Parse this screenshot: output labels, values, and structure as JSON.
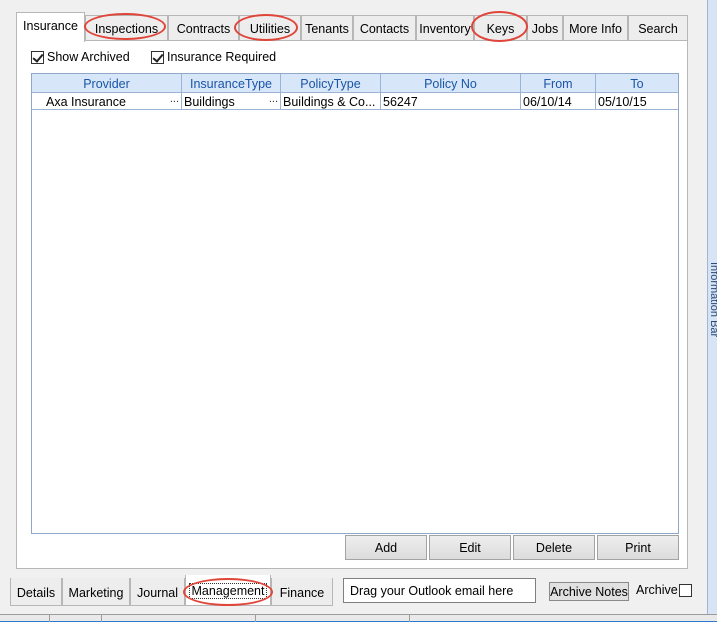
{
  "top_tabs": [
    "Insurance",
    "Inspections",
    "Contracts",
    "Utilities",
    "Tenants",
    "Contacts",
    "Inventory",
    "Keys",
    "Jobs",
    "More Info",
    "Search"
  ],
  "filters": {
    "show_archived": "Show Archived",
    "insurance_required": "Insurance Required"
  },
  "grid": {
    "columns": [
      "Provider",
      "InsuranceType",
      "PolicyType",
      "Policy No",
      "From",
      "To"
    ],
    "rows": [
      [
        "Axa Insurance",
        "Buildings",
        "Buildings & Co...",
        "56247",
        "06/10/14",
        "05/10/15"
      ]
    ]
  },
  "actions": {
    "add": "Add",
    "edit": "Edit",
    "delete": "Delete",
    "print": "Print"
  },
  "bottom_tabs": [
    "Details",
    "Marketing",
    "Journal",
    "Management",
    "Finance"
  ],
  "outlook_drop": "Drag your Outlook email here",
  "archive_notes": "Archive Notes",
  "archive_label": "Archive",
  "side_panel_label": "Information Bar",
  "colors": {
    "highlight_circle": "#e0453a",
    "grid_header": "#d7e6f8",
    "grid_header_text": "#1a55a8"
  }
}
